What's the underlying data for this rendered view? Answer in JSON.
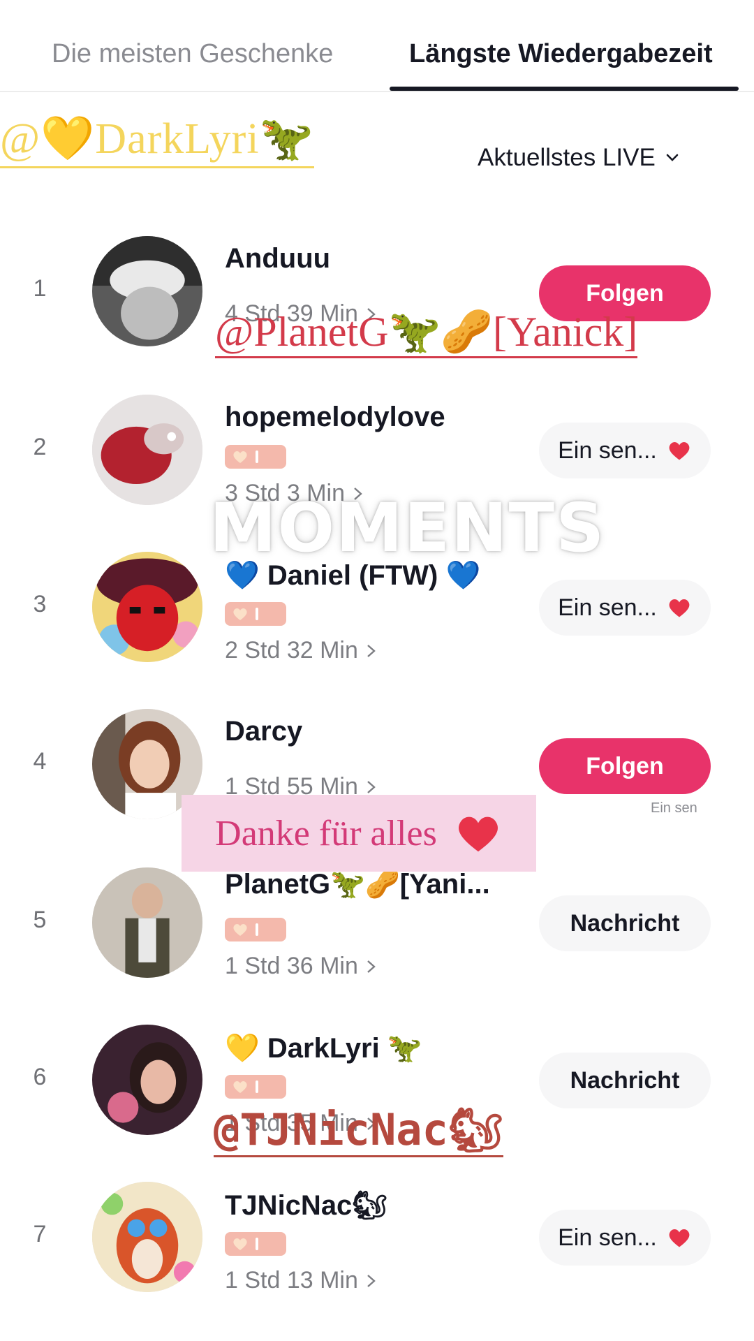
{
  "tabs": [
    {
      "label": "Die meisten Geschenke",
      "active": false
    },
    {
      "label": "Längste Wiedergabezeit",
      "active": true
    }
  ],
  "filter": {
    "label": "Aktuellstes LIVE"
  },
  "rows": [
    {
      "rank": "1",
      "name": "Anduuu",
      "duration": "4 Std 39 Min",
      "button": "Folgen",
      "button_type": "follow"
    },
    {
      "rank": "2",
      "name": "hopemelodylove",
      "duration": "3 Std 3 Min",
      "button": "Ein sen...",
      "button_type": "send"
    },
    {
      "rank": "3",
      "name": "💙 Daniel (FTW) 💙",
      "duration": "2 Std 32 Min",
      "button": "Ein sen...",
      "button_type": "send"
    },
    {
      "rank": "4",
      "name": "Darcy",
      "duration": "1 Std 55 Min",
      "button": "Folgen",
      "button_type": "follow"
    },
    {
      "rank": "5",
      "name": "PlanetG🦖🥜[Yani...",
      "duration": "1 Std 36 Min",
      "button": "Nachricht",
      "button_type": "message"
    },
    {
      "rank": "6",
      "name": "💛 DarkLyri 🦖",
      "duration": "1 Std 35 Min",
      "button": "Nachricht",
      "button_type": "message"
    },
    {
      "rank": "7",
      "name": "TJNicNac🐿",
      "duration": "1 Std 13 Min",
      "button": "Ein sen...",
      "button_type": "send"
    }
  ],
  "overlays": {
    "darklyri": "@💛DarkLyri🦖",
    "planetg": "@PlanetG🦖🥜[Yanick]",
    "moments": "MOMENTS",
    "thanks": "Danke für alles",
    "tjnicnac": "@TJNicNac🐿",
    "ein_sen_small": "Ein sen"
  },
  "colors": {
    "accent": "#e8336a",
    "badge": "#f4b9ac",
    "heart": "#e8334a"
  }
}
